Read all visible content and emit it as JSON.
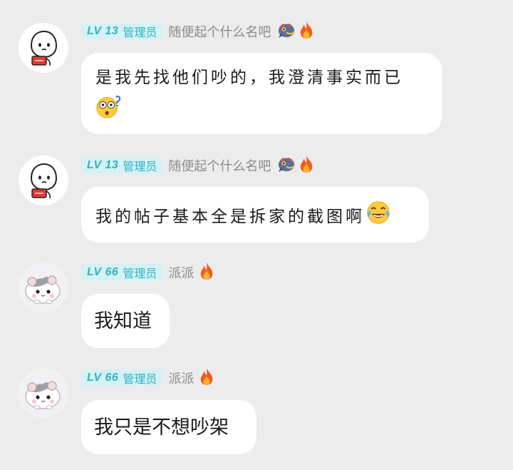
{
  "messages": [
    {
      "badge_level": "LV 13",
      "badge_role": "管理员",
      "username": "随便起个什么名吧",
      "medal_icons": [
        "dragon-medal-icon",
        "fire-icon"
      ],
      "text": "是我先找他们吵的，我澄清事实而已",
      "trailing_emoji": "shocked-face-emoji-icon",
      "avatar": "doodle-person-avatar"
    },
    {
      "badge_level": "LV 13",
      "badge_role": "管理员",
      "username": "随便起个什么名吧",
      "medal_icons": [
        "dragon-medal-icon",
        "fire-icon"
      ],
      "text": "我的帖子基本全是拆家的截图啊",
      "trailing_emoji": "laughing-tears-emoji-icon",
      "avatar": "doodle-person-avatar"
    },
    {
      "badge_level": "LV 66",
      "badge_role": "管理员",
      "username": "派派",
      "medal_icons": [
        "fire-icon"
      ],
      "text": "我知道",
      "avatar": "hamster-avatar"
    },
    {
      "badge_level": "LV 66",
      "badge_role": "管理员",
      "username": "派派",
      "medal_icons": [
        "fire-icon"
      ],
      "text": "我只是不想吵架",
      "avatar": "hamster-avatar"
    }
  ],
  "colors": {
    "background": "#ececec",
    "bubble": "#ffffff",
    "badge_bg": "#d6f1f4",
    "badge_text": "#2bb4c2",
    "username": "#8b8b8b"
  }
}
